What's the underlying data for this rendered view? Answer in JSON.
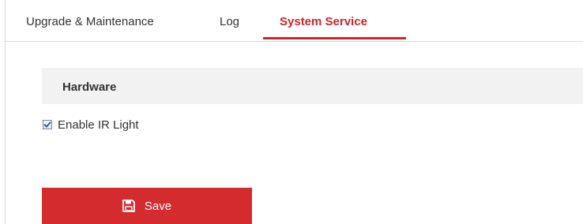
{
  "tabs": [
    {
      "label": "Upgrade & Maintenance",
      "active": false
    },
    {
      "label": "Log",
      "active": false
    },
    {
      "label": "System Service",
      "active": true
    }
  ],
  "section": {
    "title": "Hardware"
  },
  "ir_light": {
    "label": "Enable IR Light",
    "checked": true
  },
  "save": {
    "label": "Save",
    "icon": "floppy-disk-icon"
  },
  "colors": {
    "accent": "#c9262b",
    "save_button": "#d42b2f",
    "section_bg": "#f2f2f2",
    "text": "#333333"
  }
}
